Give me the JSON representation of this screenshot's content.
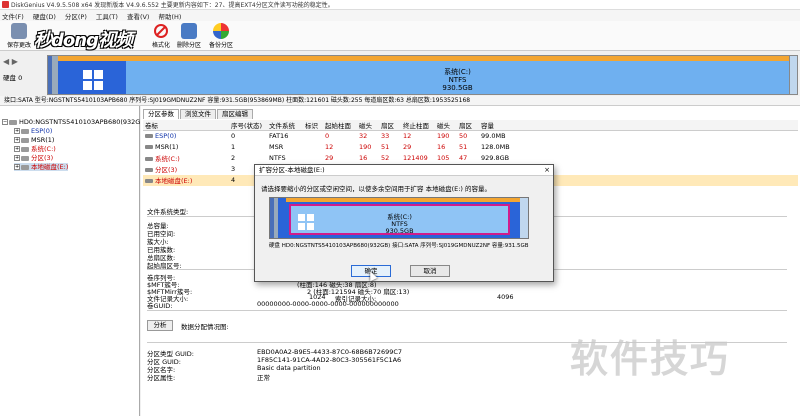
{
  "window": {
    "title": "DiskGenius V4.9.5.508 x64  发现新版本 V4.9.6.552 主要更新内容如下：27、提高EXT4分区文件读写功能的稳定性。"
  },
  "menu": [
    "文件(F)",
    "硬盘(D)",
    "分区(P)",
    "工具(T)",
    "查看(V)",
    "帮助(H)"
  ],
  "toolbar": {
    "save_label": "保存更改",
    "format_label": "格式化",
    "delete_label": "删除分区",
    "backup_label": "备份分区",
    "logo_text": "秒dong视频"
  },
  "disk": {
    "nav_label": "硬盘 0",
    "partition_name": "系统(C:)",
    "fs": "NTFS",
    "size": "930.5GB",
    "info_line": "接口:SATA  型号:NGSTNTS5410103APB680  序列号:SJ019GMDNUZ2NF  容量:931.5GB(953869MB)  柱面数:121601  磁头数:255  每道扇区数:63  总扇区数:1953525168"
  },
  "tree": {
    "disk_label": "HD0:NGSTNTS5410103APB680(932GB)",
    "items": [
      "ESP(0)",
      "MSR(1)",
      "系统(C:)",
      "分区(3)",
      "本地磁盘(E:)"
    ]
  },
  "tabs": [
    "分区参数",
    "浏览文件",
    "扇区编辑"
  ],
  "table": {
    "headers": [
      "卷标",
      "序号(状态)",
      "文件系统",
      "标识",
      "起始柱面",
      "磁头",
      "扇区",
      "终止柱面",
      "磁头",
      "扇区",
      "容量"
    ],
    "rows": [
      [
        "ESP(0)",
        "0",
        "FAT16",
        "",
        "0",
        "32",
        "33",
        "12",
        "190",
        "50",
        "99.0MB"
      ],
      [
        "MSR(1)",
        "1",
        "MSR",
        "",
        "12",
        "190",
        "51",
        "29",
        "16",
        "51",
        "128.0MB"
      ],
      [
        "系统(C:)",
        "2",
        "NTFS",
        "",
        "29",
        "16",
        "52",
        "121409",
        "105",
        "47",
        "929.8GB"
      ],
      [
        "分区(3)",
        "3",
        "",
        "",
        "",
        "",
        "",
        "",
        "",
        "",
        ""
      ],
      [
        "本地磁盘(E:)",
        "4",
        "",
        "",
        "",
        "",
        "",
        "",
        "",
        "",
        ""
      ]
    ]
  },
  "details": {
    "fs_type_label": "文件系统类型:",
    "total_capacity": "总容量:",
    "used_space": "已用空间:",
    "cluster_size": "簇大小:",
    "used_clusters": "已用簇数:",
    "total_sectors": "总扇区数:",
    "start_sector": "起始扇区号:",
    "serial": "卷序列号:",
    "mft_cluster": "$MFT簇号:",
    "mftmirr_cluster": "$MFTMirr簇号:",
    "record_size": "文件记录大小:",
    "guid_label": "卷GUID:",
    "mft_value": "(柱面:146 磁头:38 扇区:8)",
    "mftmirr_value": "2 (柱面:121594 磁头:70 扇区:13)",
    "record_value": "1024",
    "index_label": "索引记录大小:",
    "index_value": "4096",
    "guid_value": "00000000-0000-0000-0000-000000000000",
    "analyze_button": "分析",
    "analyze_label": "数据分配情况图:",
    "type_guid_label": "分区类型 GUID:",
    "type_guid_value": "EBD0A0A2-B9E5-4433-87C0-68B6B72699C7",
    "part_guid_label": "分区 GUID:",
    "part_guid_value": "1F85C141-91CA-4AD2-80C3-305561F5C1A6",
    "part_name_label": "分区名字:",
    "part_name_value": "Basic data partition",
    "attr_label": "分区属性:",
    "attr_value": "正常"
  },
  "dialog": {
    "title": "扩容分区-本地磁盘(E:)",
    "close": "×",
    "prompt": "请选择要缩小的分区或空闲空间，以使多余空间用于扩容 本地磁盘(E:) 的容量。",
    "part_name": "系统(C:)",
    "fs": "NTFS",
    "size": "930.5GB",
    "info": "硬盘 HD0:NGSTNTS5410103APB680(932GB)   接口:SATA  序列号:SJ019GMDNUZ2NF  容量:931.5GB",
    "ok": "确定",
    "cancel": "取消"
  },
  "watermark": "软件技巧",
  "colors": {
    "accent": "#2a64d8",
    "selection": "#d01c8b",
    "partition_header": "#f3a531"
  }
}
